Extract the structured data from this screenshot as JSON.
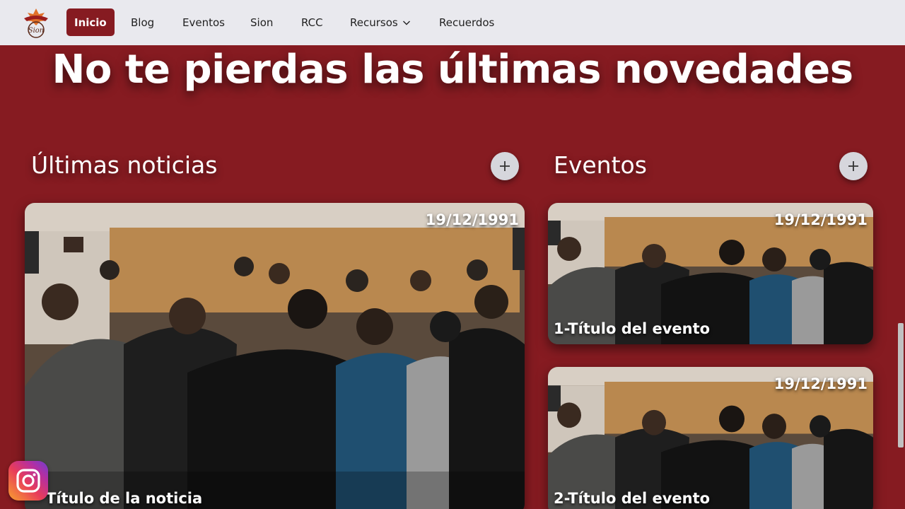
{
  "nav": {
    "logo_text": "Sion",
    "items": [
      {
        "label": "Inicio",
        "active": true
      },
      {
        "label": "Blog"
      },
      {
        "label": "Eventos"
      },
      {
        "label": "Sion"
      },
      {
        "label": "RCC"
      },
      {
        "label": "Recursos",
        "has_dropdown": true,
        "icon": "chevron-down-icon"
      },
      {
        "label": "Recuerdos"
      }
    ]
  },
  "hero": {
    "title": "No te pierdas las últimas novedades"
  },
  "news": {
    "title": "Últimas noticias",
    "add_icon": "plus-icon",
    "card": {
      "date": "19/12/1991",
      "title": "Título de la noticia"
    }
  },
  "events": {
    "title": "Eventos",
    "add_icon": "plus-icon",
    "cards": [
      {
        "date": "19/12/1991",
        "title": "1-Título del evento"
      },
      {
        "date": "19/12/1991",
        "title": "2-Título del evento"
      }
    ]
  },
  "social": {
    "icon": "instagram-icon"
  },
  "colors": {
    "brand": "#861b21",
    "navbar": "#e9e9ee",
    "button": "#d6d6dc"
  }
}
